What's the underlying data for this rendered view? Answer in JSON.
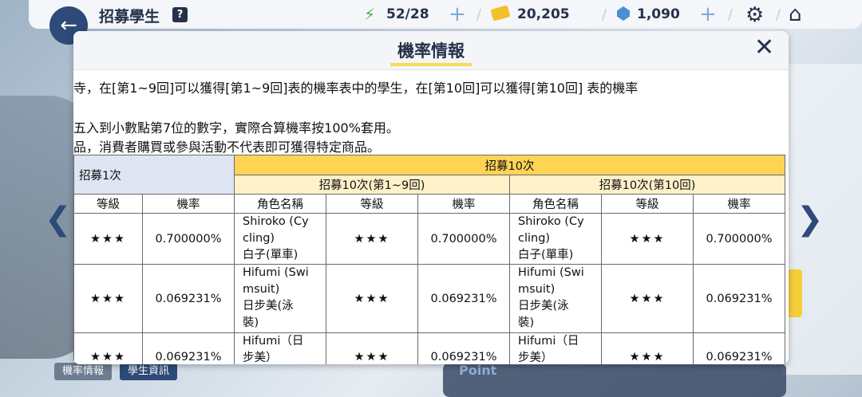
{
  "topbar": {
    "back_icon": "arrow-left-icon",
    "title": "招募學生",
    "help_label": "?",
    "ap": "52/28",
    "plus": "+",
    "credits": "20,205",
    "gems": "1,090",
    "separator": "/"
  },
  "side_nav": {
    "prev": "❮",
    "next": "❯"
  },
  "bottom_tabs": {
    "probability": "機率情報",
    "student_info": "學生資訊",
    "point_label": "Point"
  },
  "modal": {
    "title": "機率情報",
    "close": "✕",
    "paragraphs": [
      "寺，在[第1~9回]可以獲得[第1~9回]表的機率表中的學生，在[第10回]可以獲得[第10回] 表的機率",
      "五入到小數點第7位的數字，實際合算機率按100%套用。",
      "品，消費者購買或參與活動不代表即可獲得特定商品。"
    ],
    "table": {
      "header_once": "招募1次",
      "header_ten": "招募10次",
      "sub_1_9": "招募10次(第1~9回)",
      "sub_10": "招募10次(第10回)",
      "col_grade": "等級",
      "col_rate": "機率",
      "col_name": "角色名稱",
      "rows": [
        {
          "grade": "★★★",
          "rate": "0.700000%",
          "name_lines": [
            "Shiroko (Cy",
            "cling)",
            "白子(單車)"
          ]
        },
        {
          "grade": "★★★",
          "rate": "0.069231%",
          "name_lines": [
            "Hifumi (Swi",
            "msuit)",
            "日步美(泳",
            "裝)"
          ]
        },
        {
          "grade": "★★★",
          "rate": "0.069231%",
          "name_lines": [
            "Hifumi（日",
            "步美）"
          ]
        }
      ]
    }
  },
  "colors": {
    "accent_navy": "#2d4a78",
    "table_yellow": "#ffd455",
    "table_light_yellow": "#fff1c9",
    "table_blue": "#dfe5f3",
    "title_underline": "#f6dc56"
  }
}
